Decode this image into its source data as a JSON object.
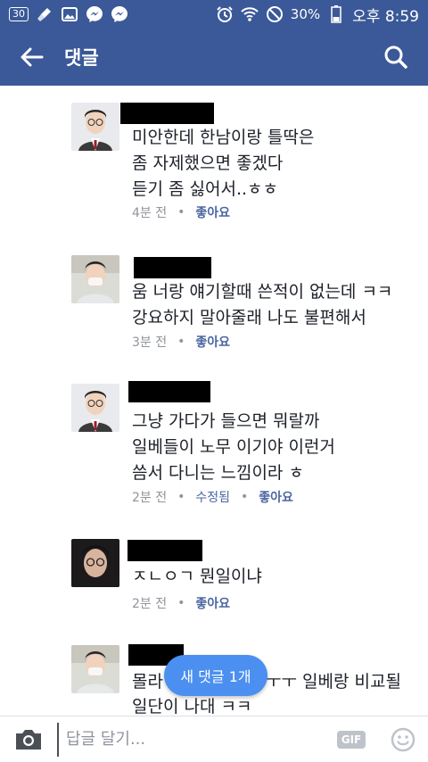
{
  "status_bar": {
    "notification_count": "30",
    "battery": "30%",
    "time": "오후 8:59"
  },
  "header": {
    "title": "댓글"
  },
  "comments": [
    {
      "text": "미안한데 한남이랑 틀딱은\n좀 자제했으면 좋겠다\n듣기 좀 싫어서..ㅎㅎ",
      "time": "4분 전",
      "like_label": "좋아요"
    },
    {
      "text": "움 너랑 얘기할때 쓴적이 없는데 ㅋㅋ\n강요하지 말아줄래 나도 불편해서",
      "time": "3분 전",
      "like_label": "좋아요"
    },
    {
      "text": "그냥 가다가 들으면 뭐랄까\n일베들이 노무 이기야 이런거\n씀서 다니는 느낌이라 ㅎ",
      "time": "2분 전",
      "edited_label": "수정됨",
      "like_label": "좋아요"
    },
    {
      "text": "ㅈㄴㅇㄱ 뭔일이냐",
      "time": "2분 전",
      "like_label": "좋아요"
    },
    {
      "text_left": "몰라",
      "text_right": "ㅜㅜ 일베랑 비교될",
      "text_line2": "일단이 나대 ㅋㅋ"
    }
  ],
  "new_comments_pill": "새 댓글 1개",
  "reply_bar": {
    "placeholder": "답글 달기...",
    "gif_label": "GIF"
  },
  "colors": {
    "brand": "#3b5998",
    "pill": "#4b8ff0",
    "link": "#4b67a1",
    "meta": "#90949c"
  },
  "icons": [
    "back-arrow-icon",
    "search-icon",
    "camera-icon",
    "gif-icon",
    "emoji-icon"
  ]
}
